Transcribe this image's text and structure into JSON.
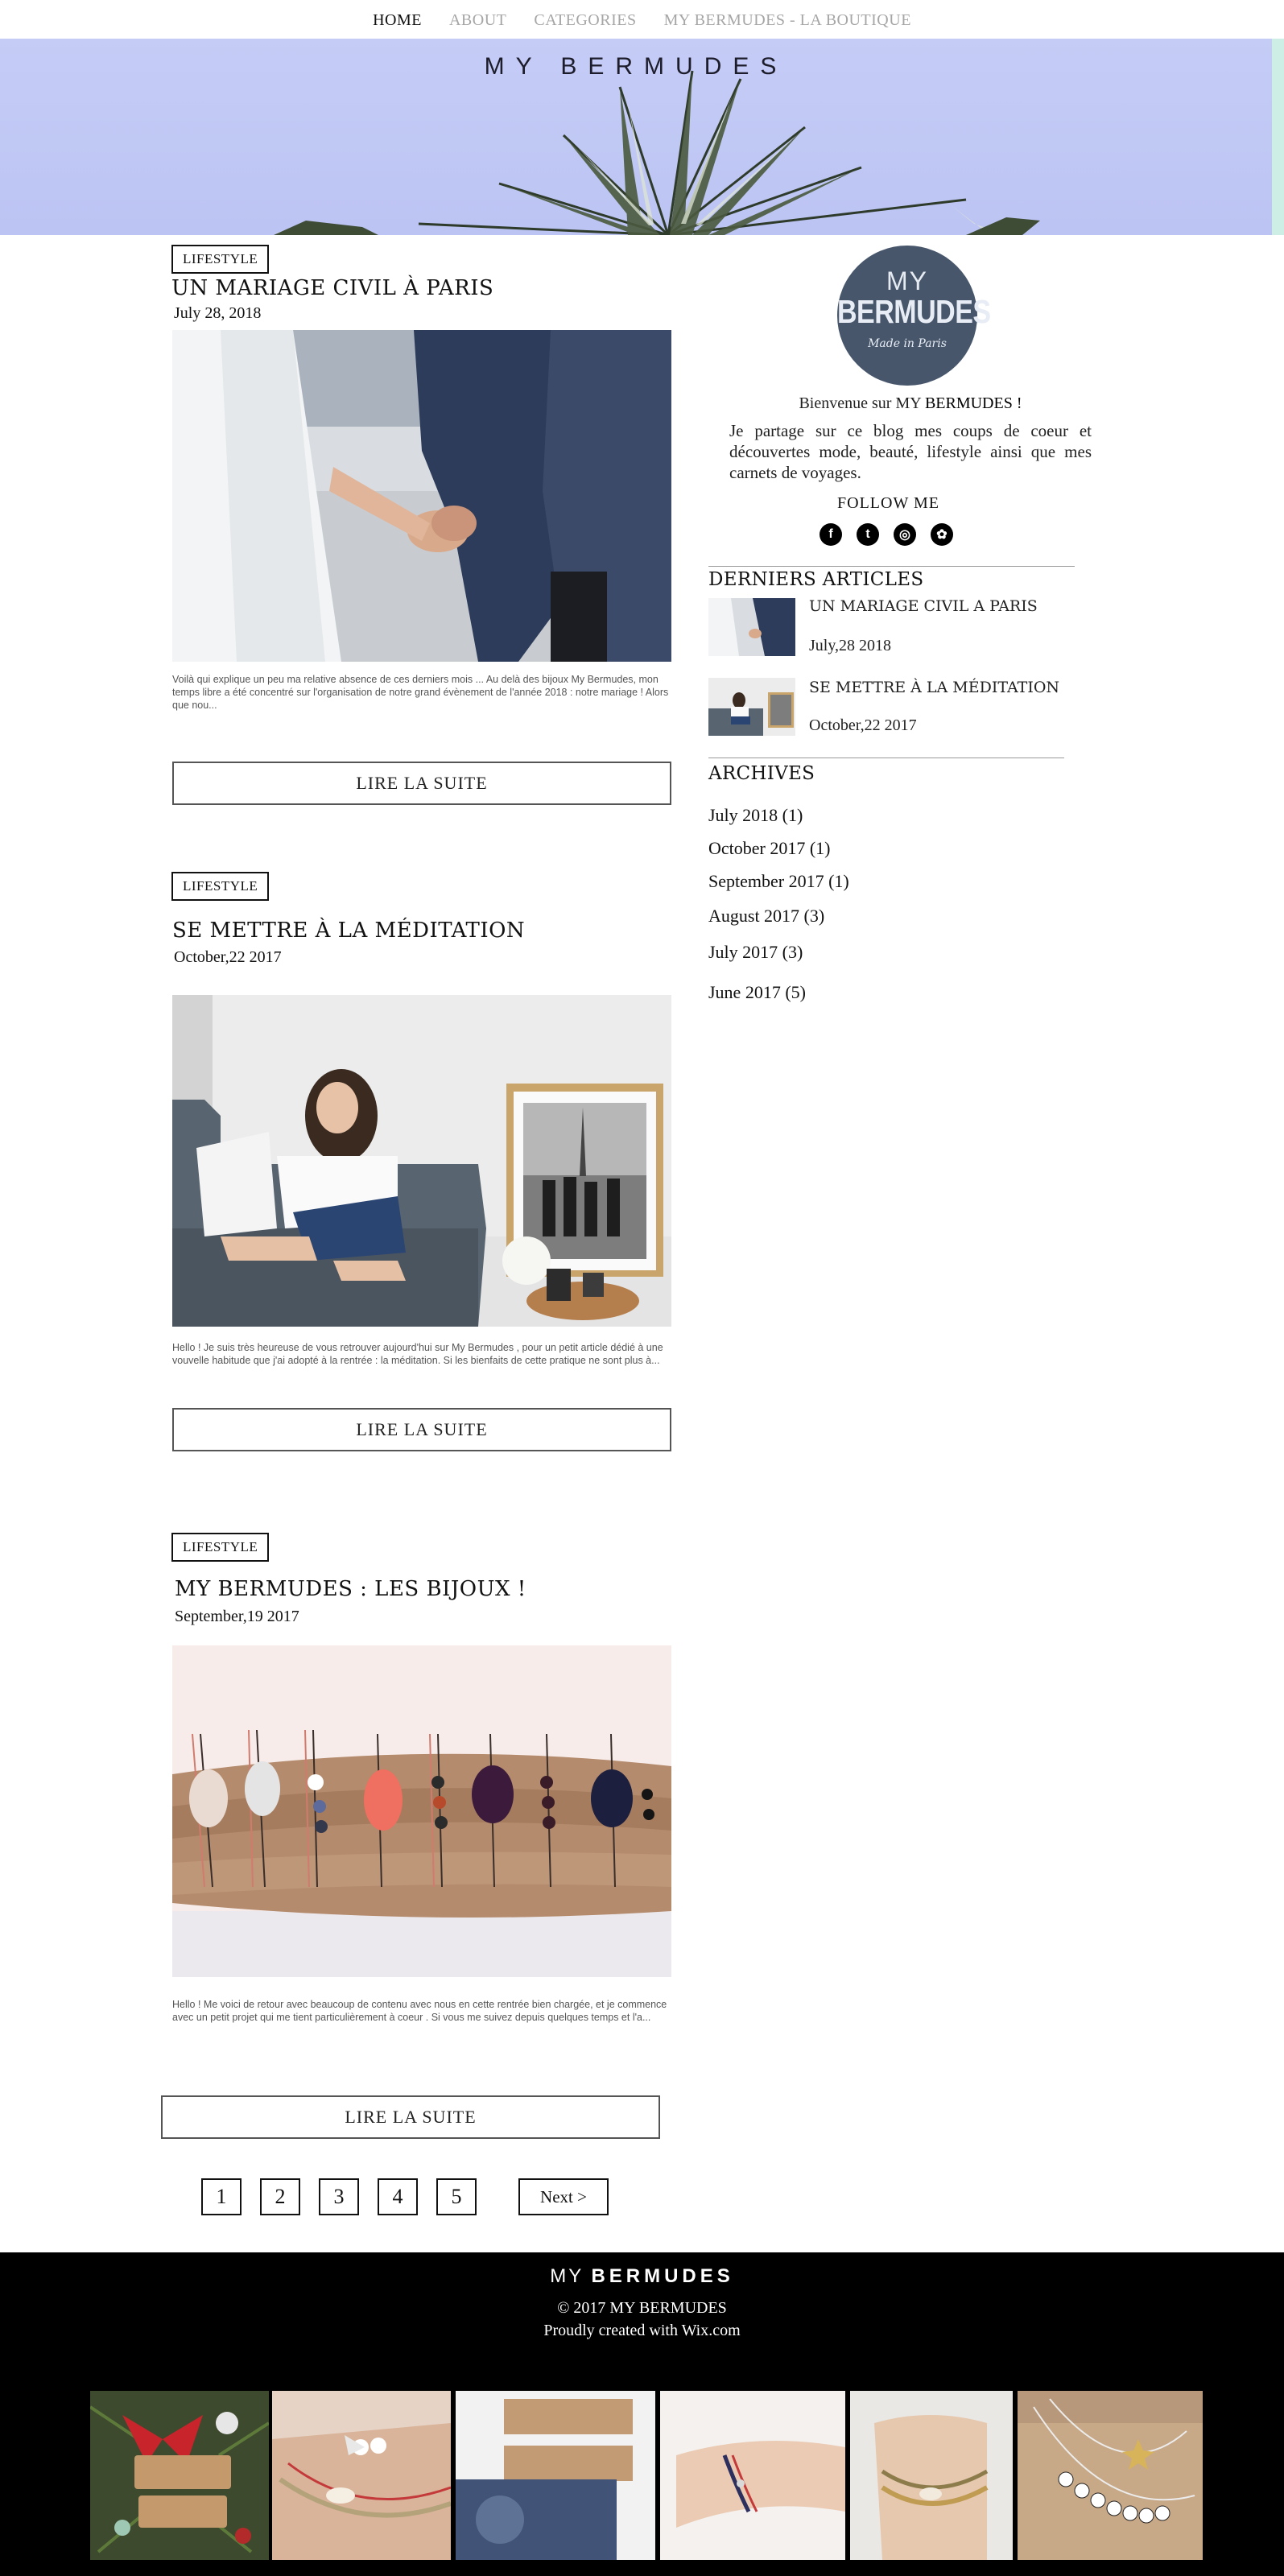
{
  "nav": {
    "items": [
      {
        "label": "HOME"
      },
      {
        "label": "ABOUT"
      },
      {
        "label": "CATEGORIES"
      },
      {
        "label": "MY BERMUDES - LA BOUTIQUE"
      }
    ]
  },
  "hero": {
    "title": "MY BERMUDES"
  },
  "posts": [
    {
      "category": "LIFESTYLE",
      "title": "UN MARIAGE CIVIL À PARIS",
      "date": "July 28, 2018",
      "excerpt": "Voilà qui explique un peu  ma relative absence  de ces derniers mois ... Au delà des bijoux My Bermudes, mon temps libre a été concentré sur l'organisation de notre grand évènement de l'année 2018 : notre mariage ! Alors que nou...",
      "read_more": "LIRE LA SUITE"
    },
    {
      "category": "LIFESTYLE",
      "title": "SE METTRE À LA MÉDITATION",
      "date": "October,22 2017",
      "excerpt": "Hello ! Je suis très heureuse de vous retrouver aujourd'hui  sur My Bermudes , pour un petit article dédié à une vouvelle habitude  que j'ai adopté à la rentrée : la méditation. Si les bienfaits de cette pratique ne sont plus à...",
      "read_more": "LIRE LA SUITE"
    },
    {
      "category": "LIFESTYLE",
      "title": "MY BERMUDES : LES BIJOUX !",
      "date": "September,19 2017",
      "excerpt": "Hello ! Me voici de retour avec beaucoup de contenu avec nous en cette rentrée bien chargée, et je commence avec un petit projet qui me tient particulièrement à coeur . Si vous me suivez depuis quelques temps et l'a...",
      "read_more": "LIRE LA SUITE"
    }
  ],
  "sidebar": {
    "logo": {
      "my": "MY",
      "bermudes": "BERMUDES",
      "tagline": "Made in Paris"
    },
    "welcome_prefix": "Bienvenue sur MY ",
    "welcome_brand": "BERMUDES !",
    "intro": "Je partage sur ce blog mes coups de coeur et découvertes mode, beauté, lifestyle ainsi que mes carnets de voyages.",
    "follow_label": "FOLLOW ME",
    "social": [
      {
        "icon": "facebook-icon",
        "glyph": "f"
      },
      {
        "icon": "twitter-icon",
        "glyph": "t"
      },
      {
        "icon": "instagram-icon",
        "glyph": "◎"
      },
      {
        "icon": "flower-icon",
        "glyph": "✿"
      }
    ],
    "recent_heading": "DERNIERS ARTICLES",
    "recent": [
      {
        "title": "UN MARIAGE CIVIL A PARIS",
        "date": "July,28 2018"
      },
      {
        "title": "SE METTRE À LA MÉDITATION",
        "date": "October,22 2017"
      }
    ],
    "archives_heading": "ARCHIVES",
    "archives": [
      "July 2018 (1)",
      "October 2017 (1)",
      "September 2017 (1)",
      "August 2017 (3)",
      "July 2017 (3)",
      "June 2017 (5)"
    ]
  },
  "pagination": {
    "pages": [
      "1",
      "2",
      "3",
      "4",
      "5"
    ],
    "next": "Next >"
  },
  "footer": {
    "logo_my": "MY ",
    "logo_bermudes": "BERMUDES",
    "copyright": "© 2017 MY BERMUDES",
    "credit": "Proudly created with Wix.com"
  }
}
